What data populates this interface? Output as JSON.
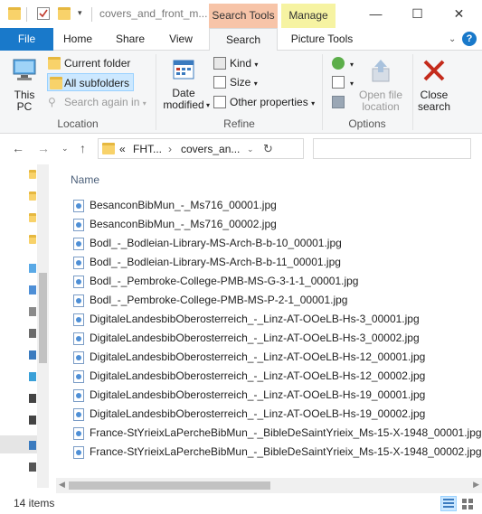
{
  "titlebar": {
    "title": "covers_and_front_m...",
    "context_search": "Search Tools",
    "context_manage": "Manage",
    "minimize": "—",
    "maximize": "☐",
    "close": "✕"
  },
  "tabs": {
    "file": "File",
    "home": "Home",
    "share": "Share",
    "view": "View",
    "search": "Search",
    "picture_tools": "Picture Tools"
  },
  "ribbon": {
    "this_pc": "This\nPC",
    "current_folder": "Current folder",
    "all_subfolders": "All subfolders",
    "search_again_in": "Search again in",
    "location_label": "Location",
    "date_modified": "Date\nmodified",
    "kind": "Kind",
    "size": "Size",
    "other_properties": "Other properties",
    "refine_label": "Refine",
    "open_file_location": "Open file\nlocation",
    "close_search": "Close\nsearch",
    "options_label": "Options"
  },
  "address": {
    "crumb_1": "FHT...",
    "crumb_2": "covers_an...",
    "overflow": "«",
    "search_placeholder": ""
  },
  "list": {
    "column_name": "Name",
    "files": [
      "BesanconBibMun_-_Ms716_00001.jpg",
      "BesanconBibMun_-_Ms716_00002.jpg",
      "Bodl_-_Bodleian-Library-MS-Arch-B-b-10_00001.jpg",
      "Bodl_-_Bodleian-Library-MS-Arch-B-b-11_00001.jpg",
      "Bodl_-_Pembroke-College-PMB-MS-G-3-1-1_00001.jpg",
      "Bodl_-_Pembroke-College-PMB-MS-P-2-1_00001.jpg",
      "DigitaleLandesbibOberosterreich_-_Linz-AT-OOeLB-Hs-3_00001.jpg",
      "DigitaleLandesbibOberosterreich_-_Linz-AT-OOeLB-Hs-3_00002.jpg",
      "DigitaleLandesbibOberosterreich_-_Linz-AT-OOeLB-Hs-12_00001.jpg",
      "DigitaleLandesbibOberosterreich_-_Linz-AT-OOeLB-Hs-12_00002.jpg",
      "DigitaleLandesbibOberosterreich_-_Linz-AT-OOeLB-Hs-19_00001.jpg",
      "DigitaleLandesbibOberosterreich_-_Linz-AT-OOeLB-Hs-19_00002.jpg",
      "France-StYrieixLaPercheBibMun_-_BibleDeSaintYrieix_Ms-15-X-1948_00001.jpg",
      "France-StYrieixLaPercheBibMun_-_BibleDeSaintYrieix_Ms-15-X-1948_00002.jpg"
    ]
  },
  "status": {
    "item_count": "14 items"
  },
  "colors": {
    "file_tab": "#1979ca",
    "search_tools_context": "#f7c4a8",
    "manage_context": "#f6f3a2",
    "selected": "#cce8ff"
  }
}
